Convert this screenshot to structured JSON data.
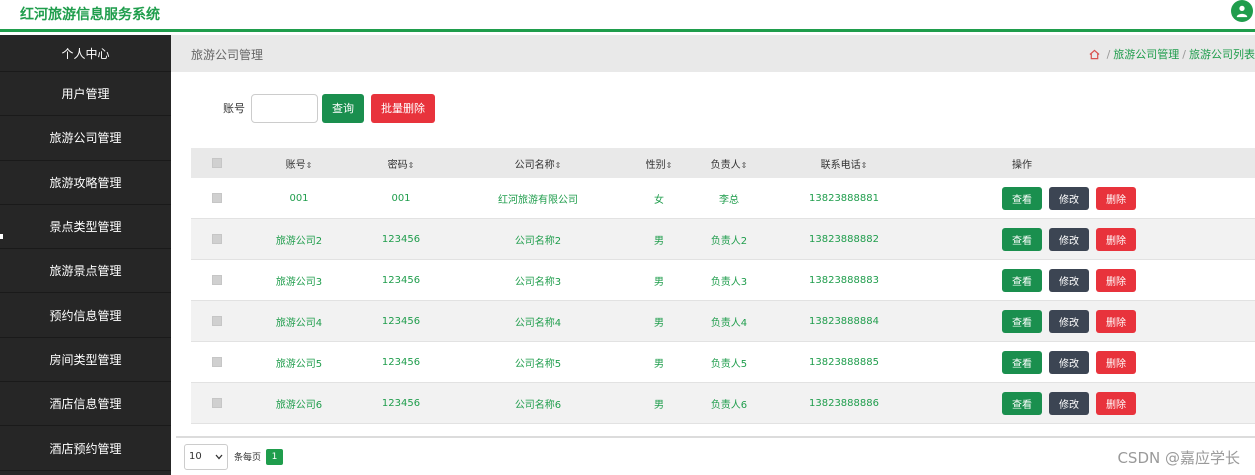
{
  "app": {
    "title": "红河旅游信息服务系统"
  },
  "sidebar": {
    "items": [
      {
        "label": "个人中心"
      },
      {
        "label": "用户管理"
      },
      {
        "label": "旅游公司管理"
      },
      {
        "label": "旅游攻略管理"
      },
      {
        "label": "景点类型管理"
      },
      {
        "label": "旅游景点管理"
      },
      {
        "label": "预约信息管理"
      },
      {
        "label": "房间类型管理"
      },
      {
        "label": "酒店信息管理"
      },
      {
        "label": "酒店预约管理"
      }
    ]
  },
  "header": {
    "title": "旅游公司管理",
    "breadcrumb": [
      "旅游公司管理",
      "旅游公司列表"
    ]
  },
  "search": {
    "label": "账号",
    "value": "",
    "query_label": "查询",
    "batch_delete_label": "批量删除"
  },
  "table": {
    "columns": [
      "账号",
      "密码",
      "公司名称",
      "性别",
      "负责人",
      "联系电话",
      "操作"
    ],
    "sort_icon": "⇕",
    "rows": [
      {
        "account": "001",
        "password": "001",
        "company": "红河旅游有限公司",
        "sex": "女",
        "manager": "李总",
        "phone": "13823888881"
      },
      {
        "account": "旅游公司2",
        "password": "123456",
        "company": "公司名称2",
        "sex": "男",
        "manager": "负责人2",
        "phone": "13823888882"
      },
      {
        "account": "旅游公司3",
        "password": "123456",
        "company": "公司名称3",
        "sex": "男",
        "manager": "负责人3",
        "phone": "13823888883"
      },
      {
        "account": "旅游公司4",
        "password": "123456",
        "company": "公司名称4",
        "sex": "男",
        "manager": "负责人4",
        "phone": "13823888884"
      },
      {
        "account": "旅游公司5",
        "password": "123456",
        "company": "公司名称5",
        "sex": "男",
        "manager": "负责人5",
        "phone": "13823888885"
      },
      {
        "account": "旅游公司6",
        "password": "123456",
        "company": "公司名称6",
        "sex": "男",
        "manager": "负责人6",
        "phone": "13823888886"
      }
    ],
    "actions": {
      "view": "查看",
      "edit": "修改",
      "delete": "删除"
    }
  },
  "pagination": {
    "page_size": "10",
    "page_size_label": "条每页",
    "current_page": "1"
  },
  "watermark": "CSDN @嘉应学长",
  "colors": {
    "accent": "#1f9d4c",
    "danger": "#e8333c",
    "edit": "#3c4553",
    "sidebar": "#262626"
  }
}
